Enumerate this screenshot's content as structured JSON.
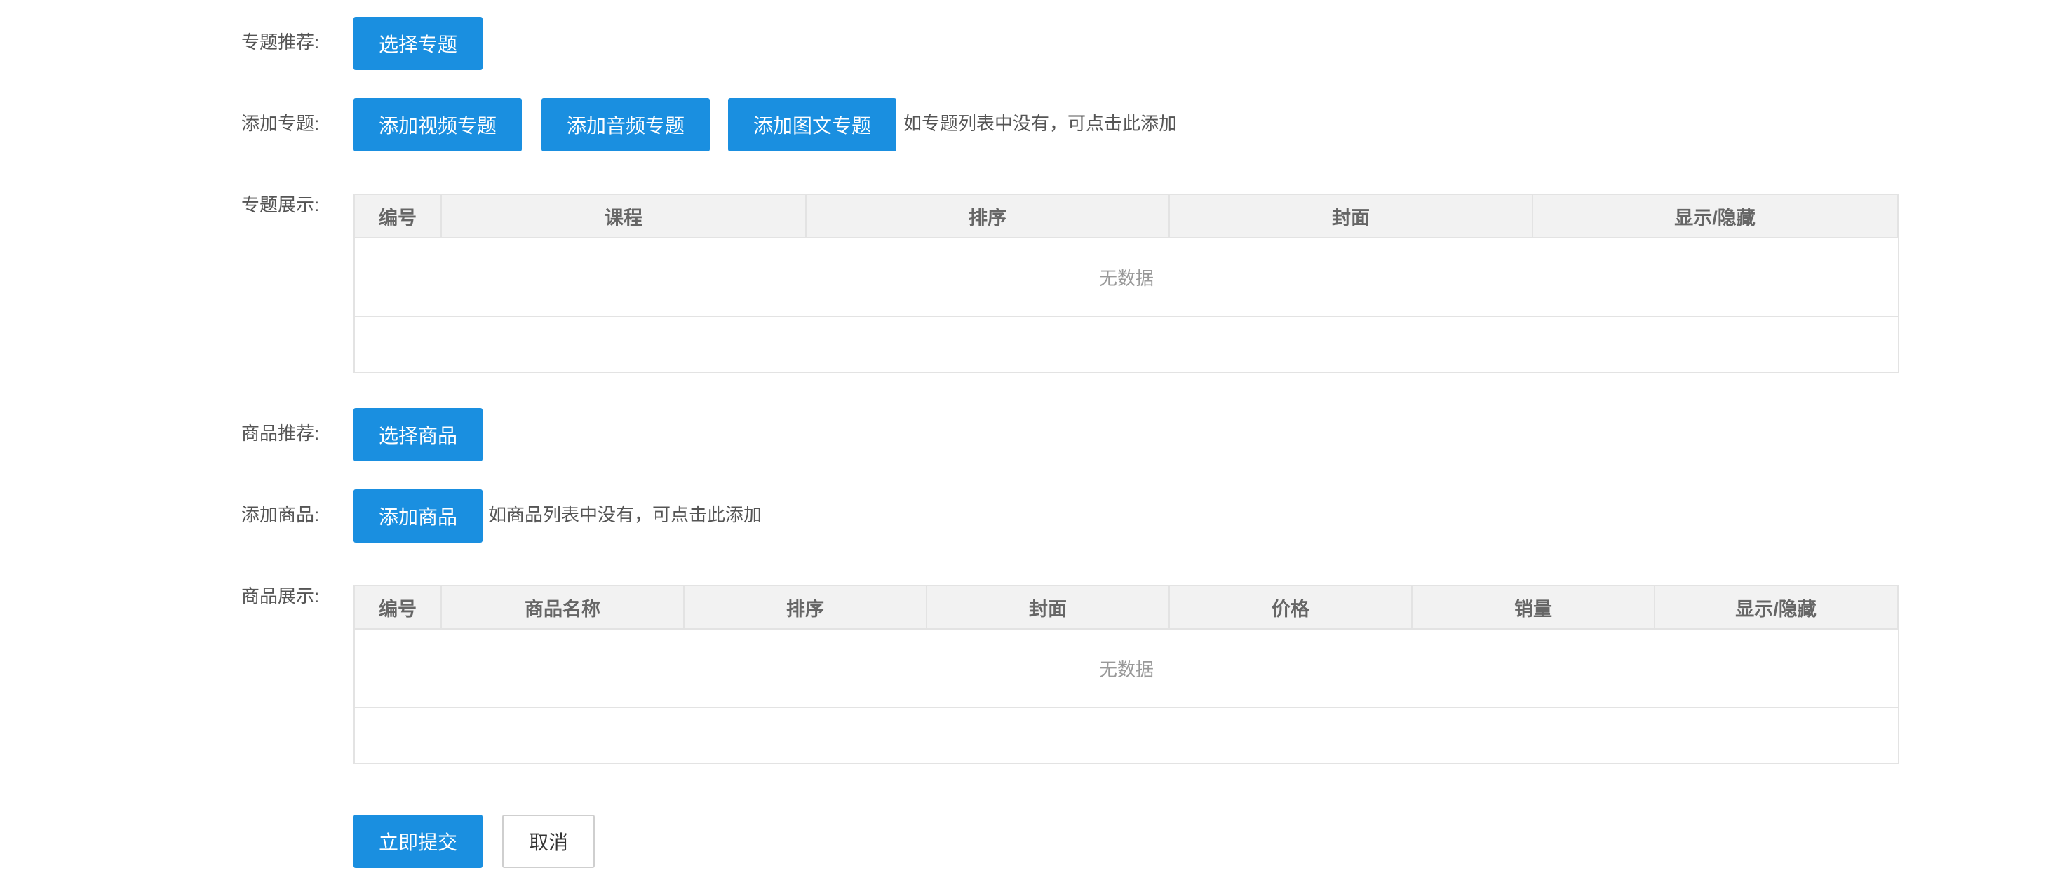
{
  "topic_recommend": {
    "label": "专题推荐:",
    "select_button": "选择专题"
  },
  "add_topic": {
    "label": "添加专题:",
    "buttons": [
      "添加视频专题",
      "添加音频专题",
      "添加图文专题"
    ],
    "hint": "如专题列表中没有，可点击此添加"
  },
  "topic_display": {
    "label": "专题展示:",
    "columns": [
      "编号",
      "课程",
      "排序",
      "封面",
      "显示/隐藏"
    ],
    "empty_text": "无数据"
  },
  "product_recommend": {
    "label": "商品推荐:",
    "select_button": "选择商品"
  },
  "add_product": {
    "label": "添加商品:",
    "button": "添加商品",
    "hint": "如商品列表中没有，可点击此添加"
  },
  "product_display": {
    "label": "商品展示:",
    "columns": [
      "编号",
      "商品名称",
      "排序",
      "封面",
      "价格",
      "销量",
      "显示/隐藏"
    ],
    "empty_text": "无数据"
  },
  "actions": {
    "submit": "立即提交",
    "cancel": "取消"
  },
  "colors": {
    "primary": "#1a8fe0",
    "border": "#e3e3e3",
    "header_bg": "#f2f2f2"
  }
}
